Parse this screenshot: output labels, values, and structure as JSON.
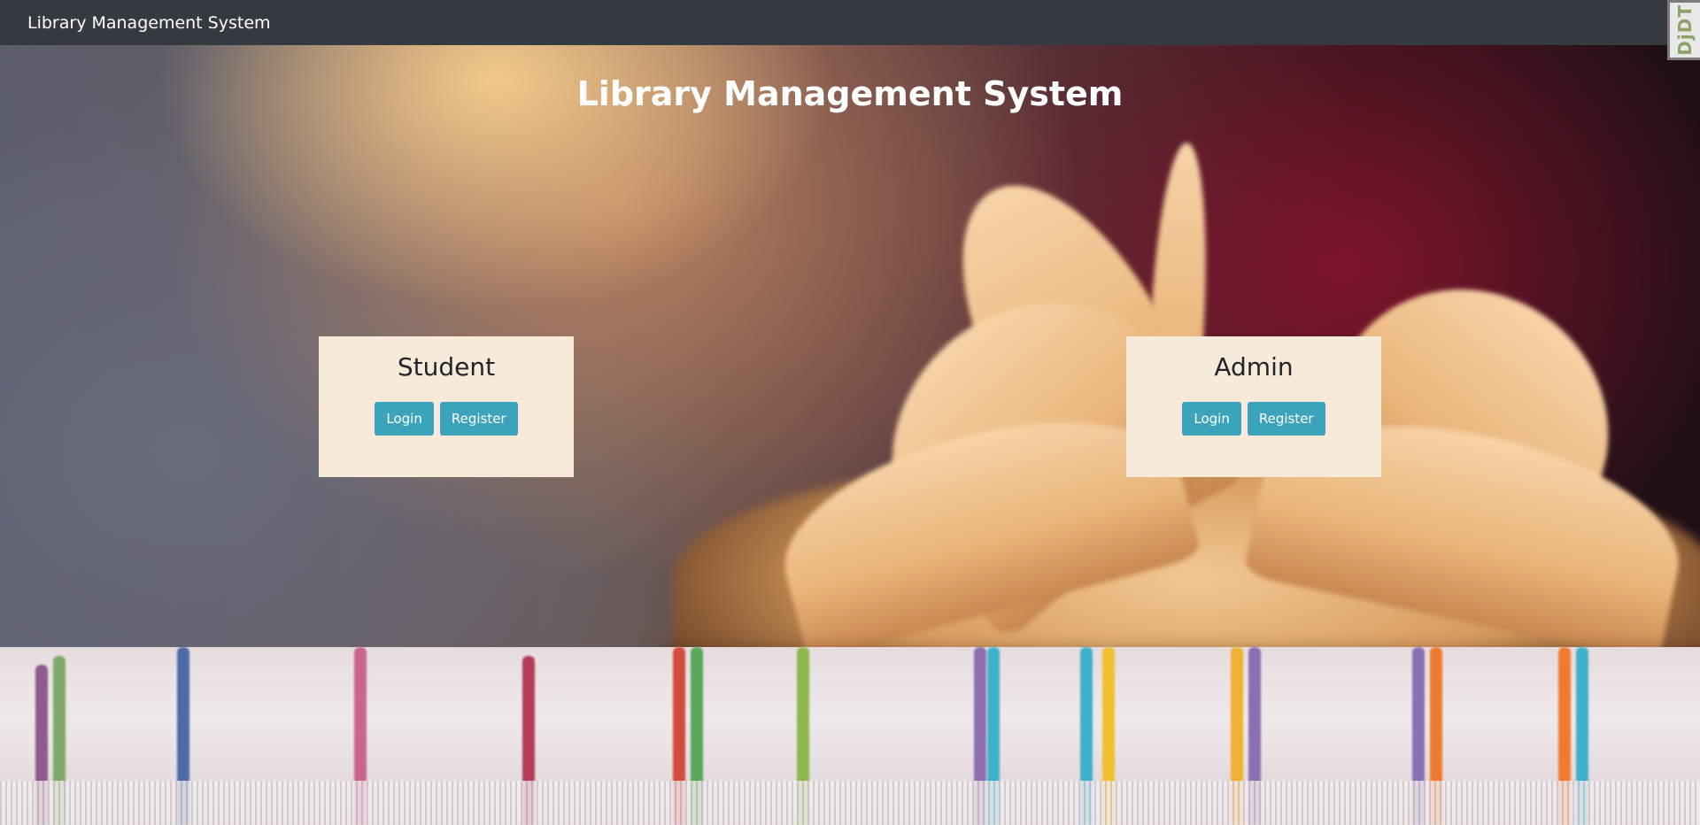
{
  "navbar": {
    "brand": "Library Management System"
  },
  "debug_toolbar": {
    "label": "DjDT"
  },
  "hero": {
    "title": "Library Management System"
  },
  "cards": {
    "student": {
      "title": "Student",
      "login_label": "Login",
      "register_label": "Register"
    },
    "admin": {
      "title": "Admin",
      "login_label": "Login",
      "register_label": "Register"
    }
  },
  "colors": {
    "navbar_bg": "#343a40",
    "card_bg": "#f7ead9",
    "button_bg": "#3ba3bb"
  }
}
